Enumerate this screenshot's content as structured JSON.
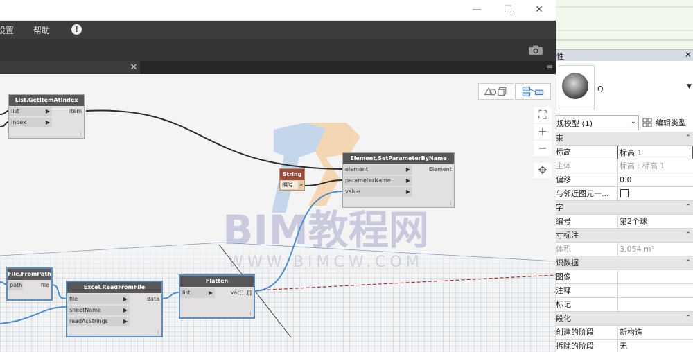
{
  "window": {
    "minimize": "—",
    "maximize": "☐",
    "close": "✕"
  },
  "menu": {
    "settings": "设置",
    "help": "帮助",
    "info": "!"
  },
  "tab": {
    "close": "✕",
    "menu": "≡"
  },
  "zoom": {
    "fit": "⛶",
    "in": "+",
    "out": "−",
    "pan": "✥"
  },
  "watermark": {
    "brand": "BIM教程网",
    "url": "WWW.BIMCW.COM"
  },
  "nodes": {
    "getitem": {
      "title": "List.GetItemAtIndex",
      "in1": "list",
      "in2": "index",
      "out": "item",
      "foot": "l"
    },
    "setparam": {
      "title": "Element.SetParameterByName",
      "in1": "element",
      "in2": "parameterName",
      "in3": "value",
      "out": "Element",
      "foot": "l"
    },
    "string": {
      "title": "String",
      "value": "编号",
      "out": ">"
    },
    "filepath": {
      "title": "File.FromPath",
      "in": "path",
      "out": "file"
    },
    "excel": {
      "title": "Excel.ReadFromFile",
      "in1": "file",
      "in2": "sheetName",
      "in3": "readAsStrings",
      "out": "data",
      "foot": "l"
    },
    "flatten": {
      "title": "Flatten",
      "in": "list",
      "out": "var[]..[]",
      "foot": "l"
    }
  },
  "properties": {
    "title": "性",
    "close": "✕",
    "preview_label": "Q",
    "type_dropdown": "规模型 (1)",
    "edit_type": "编辑类型",
    "sections": [
      {
        "name": "束",
        "rows": [
          {
            "label": "标高",
            "value": "标高 1",
            "editing": true
          },
          {
            "label": "主体",
            "value": "标高 : 标高 1",
            "readonly": true
          },
          {
            "label": "偏移",
            "value": "0.0"
          },
          {
            "label": "与邻近图元一...",
            "value": "",
            "checkbox": true
          }
        ]
      },
      {
        "name": "字",
        "rows": [
          {
            "label": "编号",
            "value": "第2个球"
          }
        ]
      },
      {
        "name": "寸标注",
        "rows": [
          {
            "label": "体积",
            "value": "3.054 m³",
            "readonly": true
          }
        ]
      },
      {
        "name": "识数据",
        "rows": [
          {
            "label": "图像",
            "value": ""
          },
          {
            "label": "注释",
            "value": ""
          },
          {
            "label": "标记",
            "value": ""
          }
        ]
      },
      {
        "name": "段化",
        "rows": [
          {
            "label": "创建的阶段",
            "value": "新构造"
          },
          {
            "label": "拆除的阶段",
            "value": "无"
          }
        ]
      }
    ]
  },
  "colors": {
    "menubar": "#3c3c3c",
    "node_header": "#575757",
    "selection": "#5b8ec7",
    "wire_blue": "#4a8dd0",
    "wire_dark": "#2d2d2d",
    "wire_red": "#b03030"
  }
}
